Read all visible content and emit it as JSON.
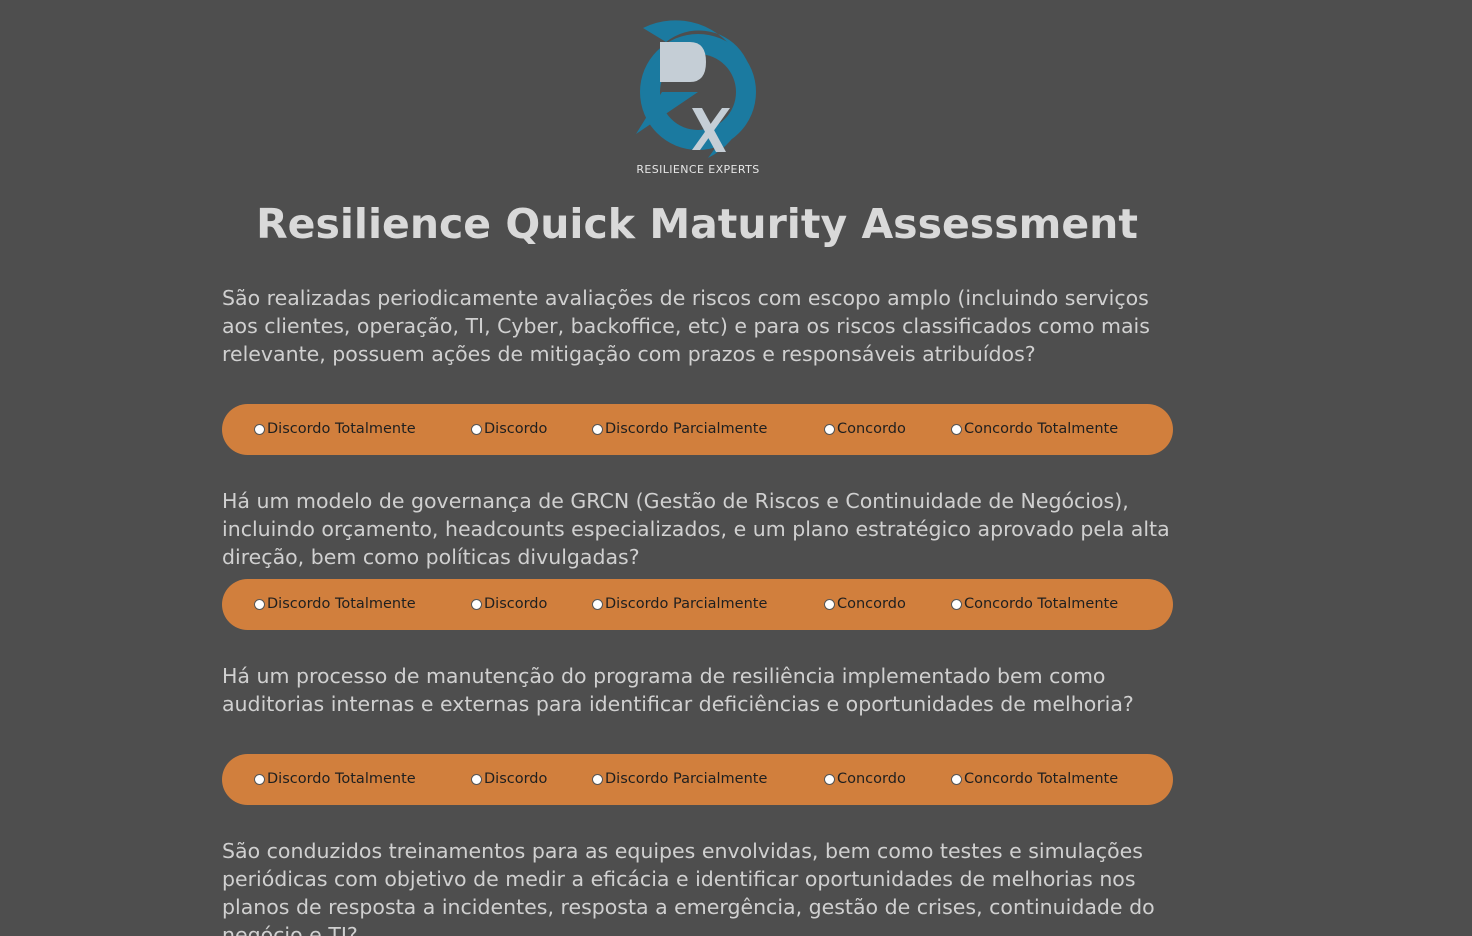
{
  "logo": {
    "caption": "RESILIENCE EXPERTS",
    "colors": {
      "ring": "#1b7aa0",
      "letter": "#c5ced6"
    }
  },
  "title": "Resilience Quick Maturity Assessment",
  "options": [
    "Discordo Totalmente",
    "Discordo",
    "Discordo Parcialmente",
    "Concordo",
    "Concordo Totalmente"
  ],
  "questions": [
    {
      "text": "São realizadas periodicamente avaliações de riscos com escopo amplo (incluindo serviços aos clientes, operação, TI, Cyber, backoffice, etc) e para os riscos classificados como mais relevante, possuem ações de mitigação com prazos e responsáveis atribuídos?"
    },
    {
      "text": "Há um modelo de governança de GRCN (Gestão de Riscos e Continuidade de Negócios), incluindo orçamento, headcounts especializados, e um plano estratégico aprovado pela alta direção, bem como políticas divulgadas?"
    },
    {
      "text": "Há um processo de manutenção do programa de resiliência implementado bem como auditorias internas e externas para identificar deficiências e oportunidades de melhoria?"
    },
    {
      "text": "São conduzidos treinamentos para as equipes envolvidas, bem como testes e simulações periódicas com objetivo de medir a eficácia e identificar oportunidades de melhorias nos planos de resposta a incidentes, resposta a emergência, gestão de crises, continuidade do negócio e TI?"
    }
  ],
  "colors": {
    "background": "#4e4e4e",
    "options_bar": "#d17f3d",
    "text": "#d0d0d0"
  }
}
